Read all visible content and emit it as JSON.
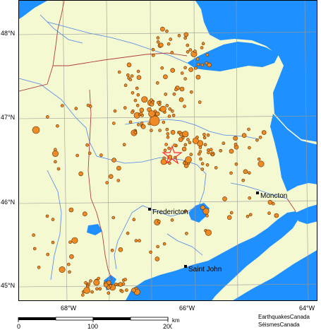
{
  "map": {
    "lat_labels": [
      "48°N",
      "47°N",
      "46°N",
      "45°N"
    ],
    "lon_labels": [
      "68°W",
      "66°W",
      "64°W"
    ],
    "cities": [
      {
        "id": "fredericton",
        "name": "Fredericton"
      },
      {
        "id": "moncton",
        "name": "Moncton"
      },
      {
        "id": "saint-john",
        "name": "Saint John"
      }
    ],
    "colors": {
      "land": "#f5f9d2",
      "water": "#1e90ff",
      "river": "#4a86e8",
      "border": "#b04040",
      "grid": "#999999",
      "quake": "#f08a24",
      "star": "#ff2a2a"
    },
    "epicenter_marker": "red-star-icon"
  },
  "scale_bar": {
    "ticks": [
      "0",
      "100",
      "200"
    ],
    "unit": "km"
  },
  "credits": {
    "line1": "EarthquakesCanada",
    "line2": "SéismesCanada"
  }
}
